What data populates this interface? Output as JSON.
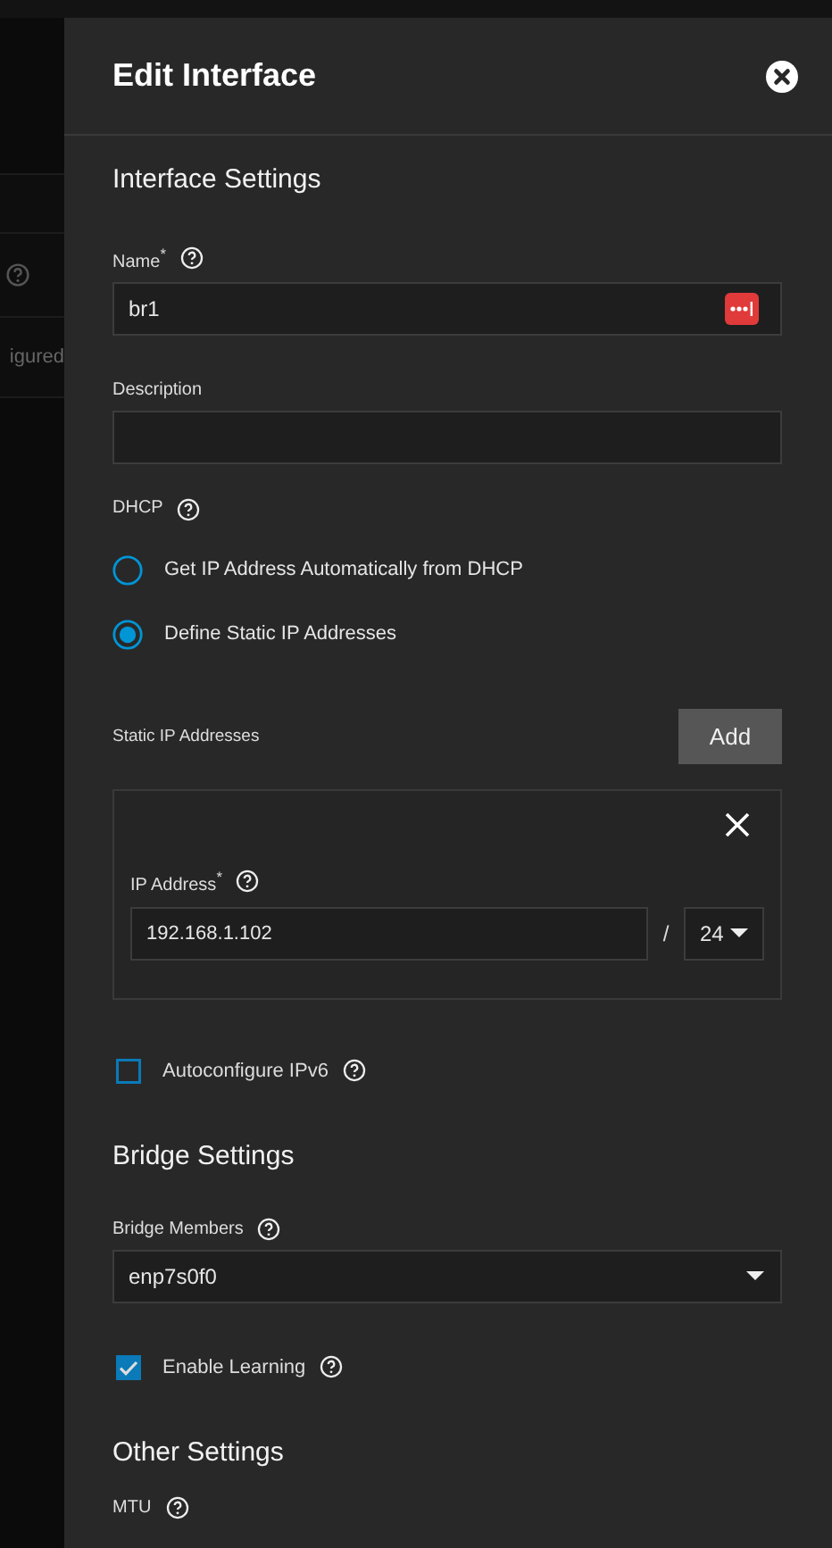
{
  "background_page": {
    "text": "igured"
  },
  "window": {
    "title": "Edit Interface"
  },
  "interface_settings": {
    "heading": "Interface Settings",
    "name": {
      "label": "Name$^{*}$",
      "value": "br1"
    },
    "description": {
      "label": "Description"
    },
    "dhcp": {
      "label": "DHCP",
      "options": [
        {
          "label": "Get IP Address Automatically from DHCP",
          "selected": false
        },
        {
          "label": "Define Static IP Addresses",
          "selected": true
        }
      ]
    },
    "static_ips": {
      "label": "Static IP Addresses",
      "add_button": "Add",
      "entries": [
        {
          "label": "IP Address$^{*}$",
          "address": "192.168.1.102",
          "separator": "/",
          "netmask": "24"
        }
      ]
    },
    "autoconfigure_ipv6": {
      "label": "Autoconfigure IPv6",
      "checked": false
    }
  },
  "bridge_settings": {
    "heading": "Bridge Settings",
    "members": {
      "label": "Bridge Members",
      "value": "enp7s0f0"
    },
    "enable_learning": {
      "label": "Enable Learning",
      "checked": true
    }
  },
  "other_settings": {
    "heading": "Other Settings",
    "fields": [
      {
        "label": "MTU"
      }
    ]
  }
}
